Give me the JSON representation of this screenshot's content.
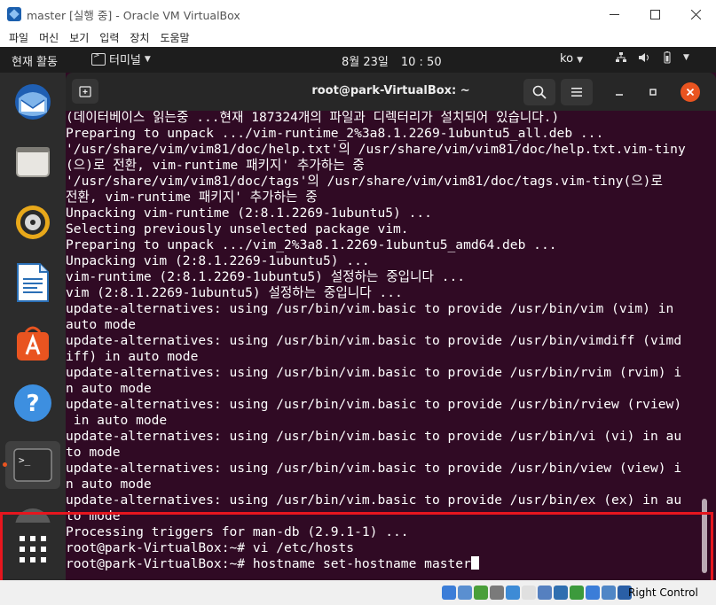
{
  "window": {
    "title": "master [실행 중] - Oracle VM VirtualBox"
  },
  "menubar": [
    "파일",
    "머신",
    "보기",
    "입력",
    "장치",
    "도움말"
  ],
  "gnome_topbar": {
    "activities": "현재 활동",
    "app_menu": "터미널",
    "clock_date": "8월 23일",
    "clock_time": "10 : 50",
    "keyboard_layout": "ko"
  },
  "dock": {
    "items": [
      "thunderbird-icon",
      "files-icon",
      "rhythmbox-icon",
      "libreoffice-writer-icon",
      "ubuntu-software-icon",
      "help-icon",
      "terminal-icon",
      "show-applications-icon"
    ],
    "running": "terminal-icon"
  },
  "terminal": {
    "title": "root@park-VirtualBox: ~",
    "lines": [
      "(데이터베이스 읽는중 ...현재 187324개의 파일과 디렉터리가 설치되어 있습니다.)",
      "Preparing to unpack .../vim-runtime_2%3a8.1.2269-1ubuntu5_all.deb ...",
      "'/usr/share/vim/vim81/doc/help.txt'의 /usr/share/vim/vim81/doc/help.txt.vim-tiny",
      "(으)로 전환, vim-runtime 패키지' 추가하는 중",
      "'/usr/share/vim/vim81/doc/tags'의 /usr/share/vim/vim81/doc/tags.vim-tiny(으)로",
      "전환, vim-runtime 패키지' 추가하는 중",
      "Unpacking vim-runtime (2:8.1.2269-1ubuntu5) ...",
      "Selecting previously unselected package vim.",
      "Preparing to unpack .../vim_2%3a8.1.2269-1ubuntu5_amd64.deb ...",
      "Unpacking vim (2:8.1.2269-1ubuntu5) ...",
      "vim-runtime (2:8.1.2269-1ubuntu5) 설정하는 중입니다 ...",
      "vim (2:8.1.2269-1ubuntu5) 설정하는 중입니다 ...",
      "update-alternatives: using /usr/bin/vim.basic to provide /usr/bin/vim (vim) in",
      "auto mode",
      "update-alternatives: using /usr/bin/vim.basic to provide /usr/bin/vimdiff (vimd",
      "iff) in auto mode",
      "update-alternatives: using /usr/bin/vim.basic to provide /usr/bin/rvim (rvim) i",
      "n auto mode",
      "update-alternatives: using /usr/bin/vim.basic to provide /usr/bin/rview (rview)",
      " in auto mode",
      "update-alternatives: using /usr/bin/vim.basic to provide /usr/bin/vi (vi) in au",
      "to mode",
      "update-alternatives: using /usr/bin/vim.basic to provide /usr/bin/view (view) i",
      "n auto mode",
      "update-alternatives: using /usr/bin/vim.basic to provide /usr/bin/ex (ex) in au",
      "to mode",
      "Processing triggers for man-db (2.9.1-1) ...",
      "root@park-VirtualBox:~# vi /etc/hosts",
      "root@park-VirtualBox:~# hostname set-hostname master"
    ]
  },
  "statusbar": {
    "host_key": "Right Control",
    "icon_colors": [
      "#3b7dd8",
      "#5a8fd0",
      "#4a9f3a",
      "#7a7a7a",
      "#3d8bd6",
      "#e0e0e0",
      "#5580c0",
      "#2f6fb0",
      "#3c9a3c",
      "#3b7dd8",
      "#4f86c6",
      "#2a5fa6"
    ]
  },
  "colors": {
    "terminal_bg": "#300a24",
    "accent": "#e95420",
    "highlight_box": "#e6161e"
  }
}
